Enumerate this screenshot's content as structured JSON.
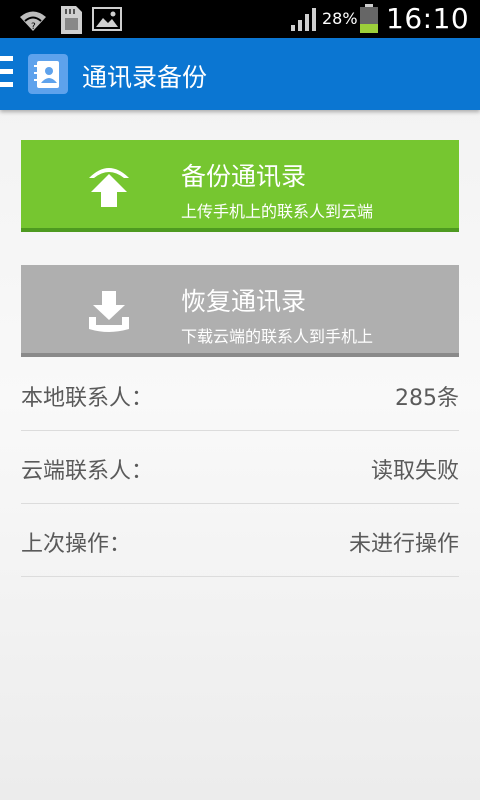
{
  "status_bar": {
    "battery_percent": "28%",
    "time": "16:10",
    "icons": [
      "wifi-icon",
      "sd-card-icon",
      "image-icon",
      "signal-icon",
      "battery-icon"
    ]
  },
  "action_bar": {
    "title": "通讯录备份",
    "icons": [
      "menu-icon",
      "contacts-book-icon"
    ]
  },
  "backup_button": {
    "title": "备份通讯录",
    "subtitle": "上传手机上的联系人到云端",
    "icon": "upload-icon",
    "color": "#76c630"
  },
  "restore_button": {
    "title": "恢复通讯录",
    "subtitle": "下载云端的联系人到手机上",
    "icon": "download-icon",
    "color": "#afafaf"
  },
  "info": {
    "local": {
      "label": "本地联系人：",
      "value": "285条"
    },
    "cloud": {
      "label": "云端联系人：",
      "value": "读取失败"
    },
    "last": {
      "label": "上次操作：",
      "value": "未进行操作"
    }
  }
}
